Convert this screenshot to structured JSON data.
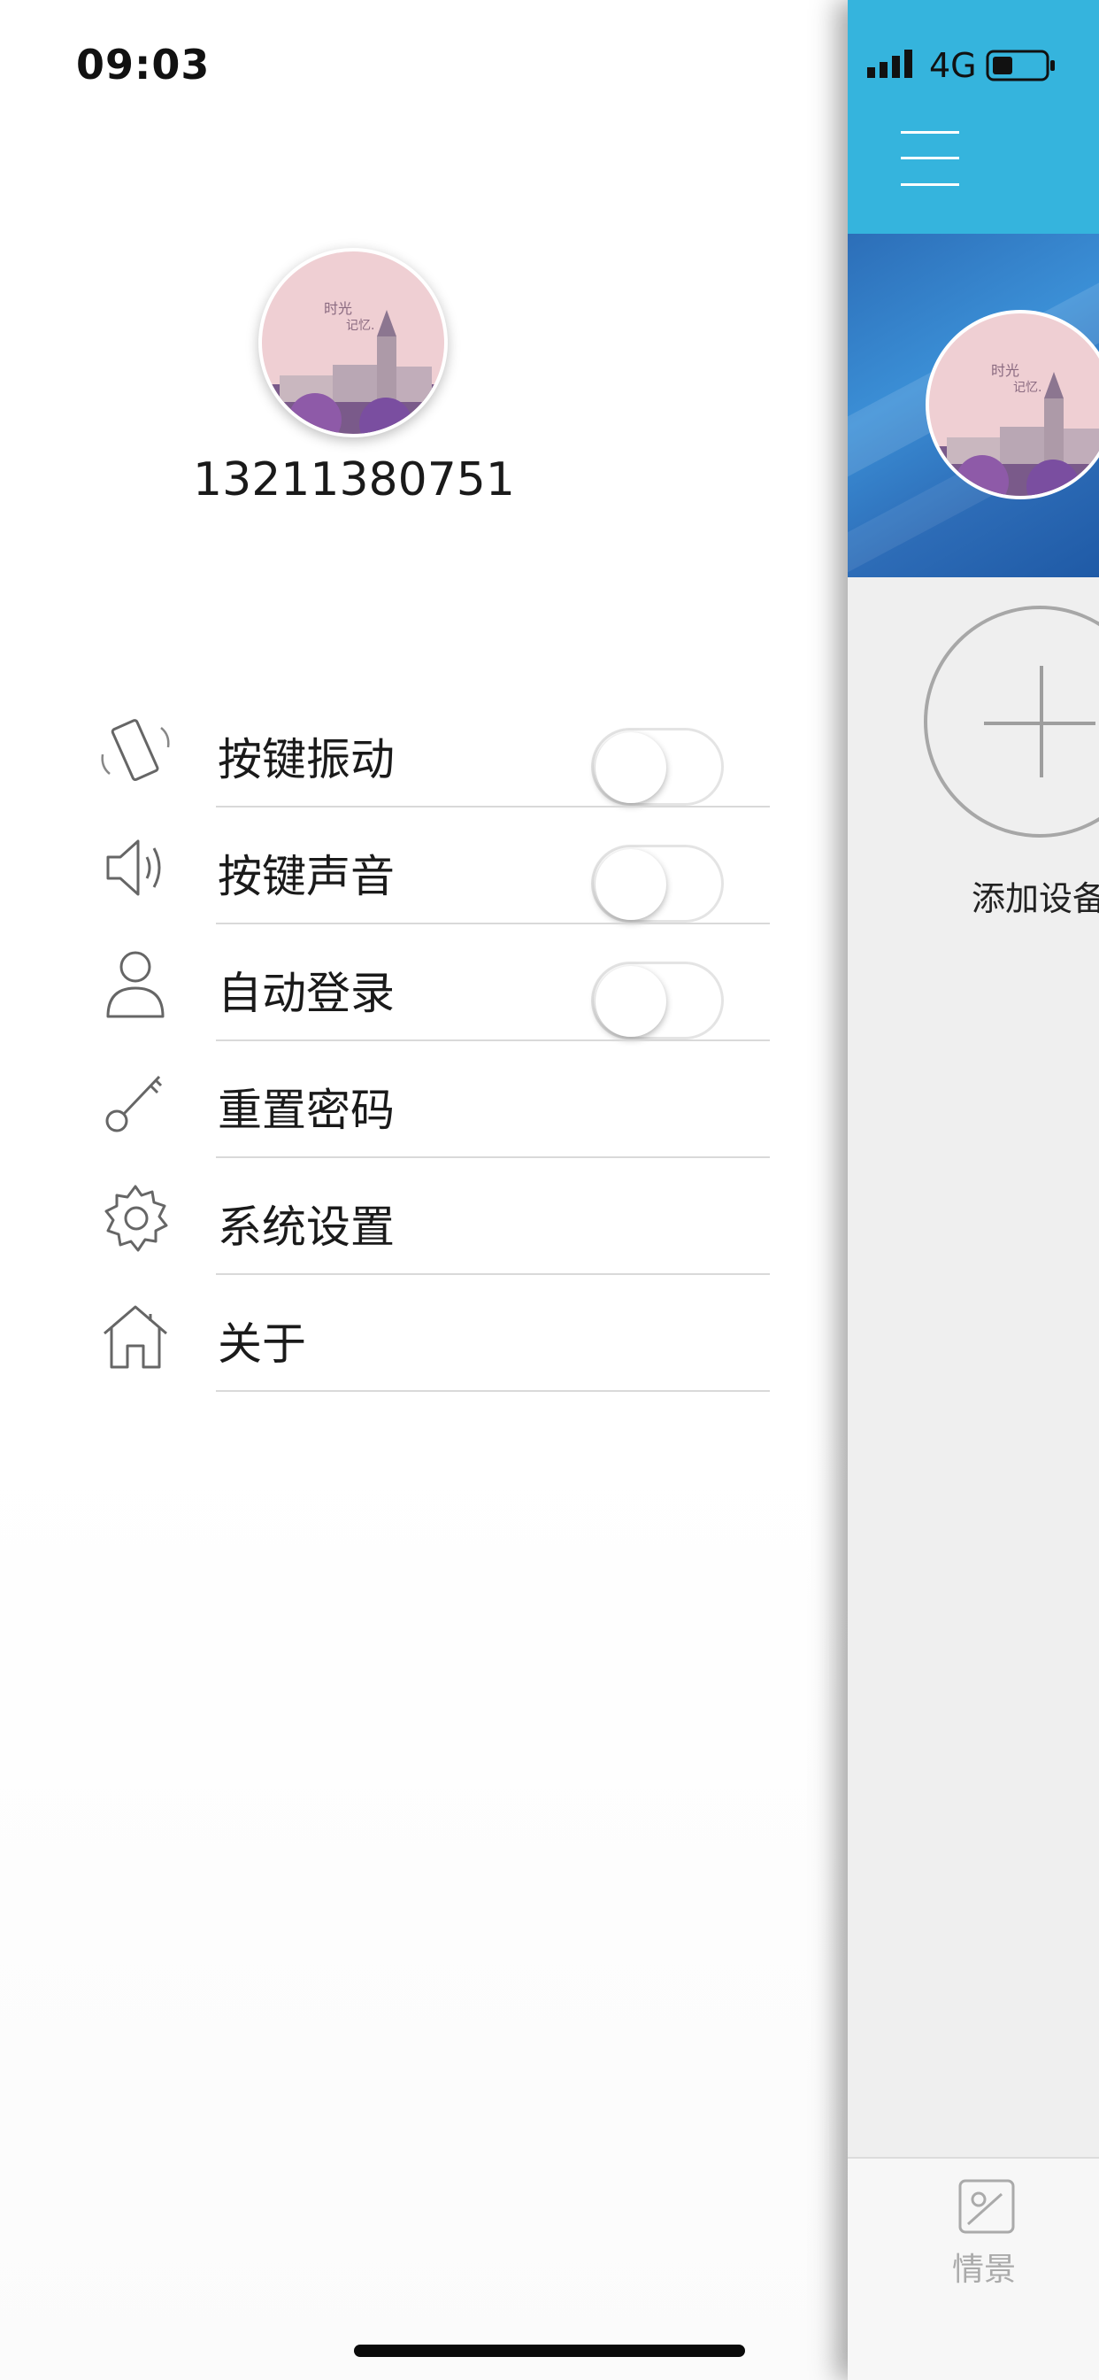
{
  "status_bar": {
    "time": "09:03",
    "network": "4G"
  },
  "drawer": {
    "phone_number": "13211380751",
    "menu": [
      {
        "label": "按键振动",
        "icon": "vibrate-icon",
        "toggle": false
      },
      {
        "label": "按键声音",
        "icon": "speaker-icon",
        "toggle": false
      },
      {
        "label": "自动登录",
        "icon": "user-icon",
        "toggle": false
      },
      {
        "label": "重置密码",
        "icon": "key-icon"
      },
      {
        "label": "系统设置",
        "icon": "gear-icon"
      },
      {
        "label": "关于",
        "icon": "home-icon"
      }
    ]
  },
  "main": {
    "add_device_label": "添加设备",
    "tabs": [
      {
        "label": "情景",
        "icon": "scene-icon"
      }
    ]
  },
  "colors": {
    "header": "#35b4dd",
    "banner": "#2d6cb7",
    "drawer_bg": "#ffffff"
  }
}
